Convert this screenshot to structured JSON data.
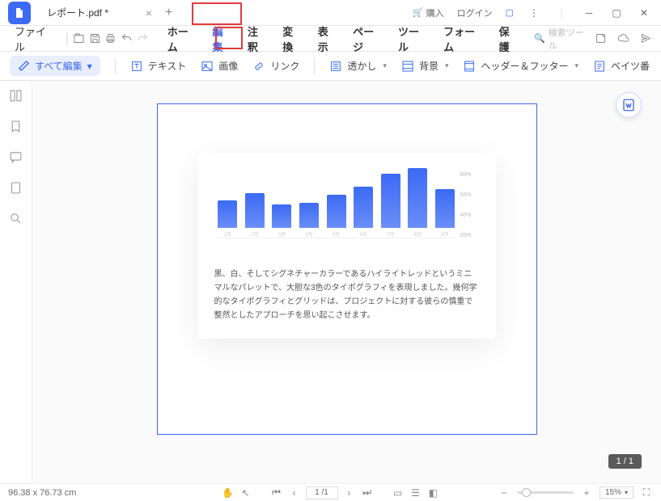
{
  "titlebar": {
    "tab_title": "レポート.pdf *",
    "buy": "購入",
    "login": "ログイン"
  },
  "menubar": {
    "file": "ファイル",
    "items": [
      "ホーム",
      "編集",
      "注釈",
      "変換",
      "表示",
      "ページ",
      "ツール",
      "フォーム",
      "保護"
    ],
    "search_placeholder": "検索ツール"
  },
  "toolbar": {
    "edit_all": "すべて編集",
    "text": "テキスト",
    "image": "画像",
    "link": "リンク",
    "watermark": "透かし",
    "background": "背景",
    "header_footer": "ヘッダー＆フッター",
    "bates": "ベイツ番"
  },
  "chart_data": {
    "type": "bar",
    "categories": [
      "1月",
      "2月",
      "3月",
      "4月",
      "5月",
      "6月",
      "7月",
      "8月",
      "9月"
    ],
    "values": [
      33,
      42,
      28,
      30,
      40,
      50,
      65,
      72,
      47
    ],
    "ylim": [
      0,
      80
    ],
    "yticks": [
      "80%",
      "60%",
      "40%",
      "20%"
    ],
    "xlabel": "",
    "ylabel": "",
    "title": ""
  },
  "doc_text": "黒、白、そしてシグネチャーカラーであるハイライトレッドというミニマルなパレットで、大胆な3色のタイポグラフィを表現しました。幾何学的なタイポグラフィとグリッドは、プロジェクトに対する彼らの慎重で整然としたアプローチを思い起こさせます。",
  "page_badge": "1 / 1",
  "statusbar": {
    "dimensions": "96.38 x 76.73 cm",
    "page_indicator": "1 /1",
    "zoom": "15%"
  }
}
